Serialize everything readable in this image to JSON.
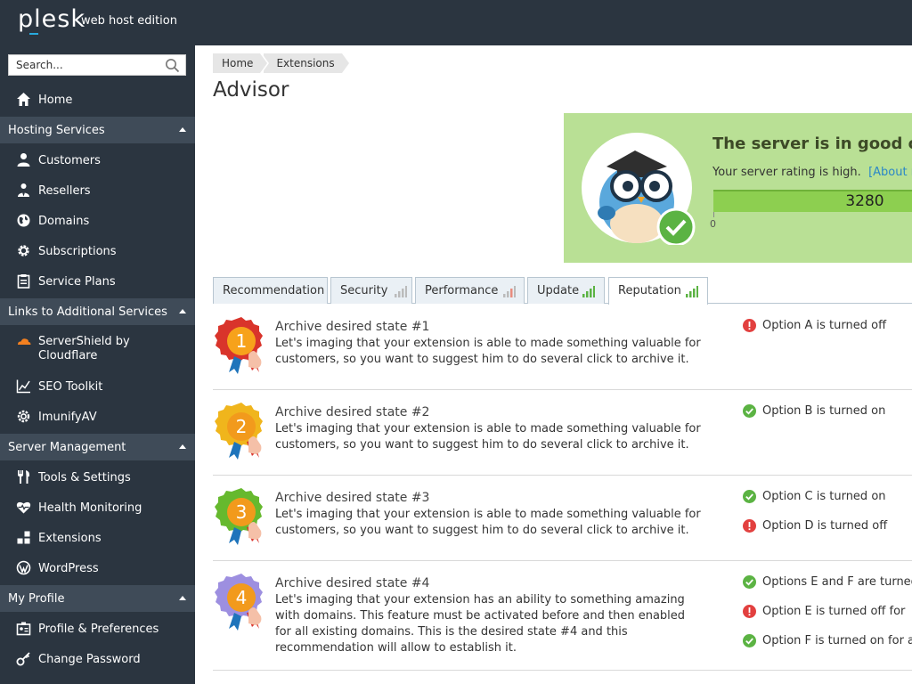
{
  "brand": {
    "logo": "plesk",
    "edition": "web host edition"
  },
  "search": {
    "placeholder": "Search..."
  },
  "sidebar": {
    "home": "Home",
    "hosting": {
      "title": "Hosting Services",
      "items": [
        "Customers",
        "Resellers",
        "Domains",
        "Subscriptions",
        "Service Plans"
      ]
    },
    "links": {
      "title": "Links to Additional Services",
      "items": [
        "ServerShield by Cloudflare",
        "SEO Toolkit",
        "ImunifyAV"
      ]
    },
    "server": {
      "title": "Server Management",
      "items": [
        "Tools & Settings",
        "Health Monitoring",
        "Extensions",
        "WordPress"
      ]
    },
    "profile": {
      "title": "My Profile",
      "items": [
        "Profile & Preferences",
        "Change Password"
      ]
    }
  },
  "breadcrumb": [
    "Home",
    "Extensions"
  ],
  "page_title": "Advisor",
  "status": {
    "title": "The server is in good cond",
    "text": "Your server rating is high.",
    "link": "[About rati",
    "score": "3280",
    "min": "0"
  },
  "tabs": [
    {
      "label": "Recommendation",
      "bars": null
    },
    {
      "label": "Security",
      "bars": "gray"
    },
    {
      "label": "Performance",
      "bars": "gray-red"
    },
    {
      "label": "Update",
      "bars": "green"
    },
    {
      "label": "Reputation",
      "bars": "green",
      "active": true
    }
  ],
  "colors": {
    "accent_green": "#8dcf50",
    "panel_green": "#b9e095",
    "link": "#2a87c7",
    "sidebar": "#2b3540",
    "error": "#e2403f",
    "ok": "#5bb343"
  },
  "recommendations": [
    {
      "rank": "1",
      "medal_color": "#d9342b",
      "title": "Archive desired state #1",
      "desc": "Let's imaging that your extension is able to made something valuable for customers, so you want to suggest him to do several click to archive it.",
      "options": [
        {
          "status": "error",
          "text": "Option A is turned off"
        }
      ]
    },
    {
      "rank": "2",
      "medal_color": "#f0b51c",
      "title": "Archive desired state #2",
      "desc": "Let's imaging that your extension is able to made something valuable for customers, so you want to suggest him to do several click to archive it.",
      "options": [
        {
          "status": "ok",
          "text": "Option B is turned on"
        }
      ]
    },
    {
      "rank": "3",
      "medal_color": "#66b92e",
      "title": "Archive desired state #3",
      "desc": "Let's imaging that your extension is able to made something valuable for customers, so you want to suggest him to do several click to archive it.",
      "options": [
        {
          "status": "ok",
          "text": "Option C is turned on"
        },
        {
          "status": "error",
          "text": "Option D is turned off"
        }
      ]
    },
    {
      "rank": "4",
      "medal_color": "#9d8fe0",
      "title": "Archive desired state #4",
      "desc": "Let's imaging that your extension has an ability to something amazing with domains. This feature must be activated before and then enabled for all existing domains. This is the desired state #4 and this recommendation will allow to establish it.",
      "options": [
        {
          "status": "ok",
          "text": "Options E and F are turned"
        },
        {
          "status": "error",
          "text": "Option E is turned off for"
        },
        {
          "status": "ok",
          "text": "Option F is turned on for all"
        }
      ]
    }
  ]
}
